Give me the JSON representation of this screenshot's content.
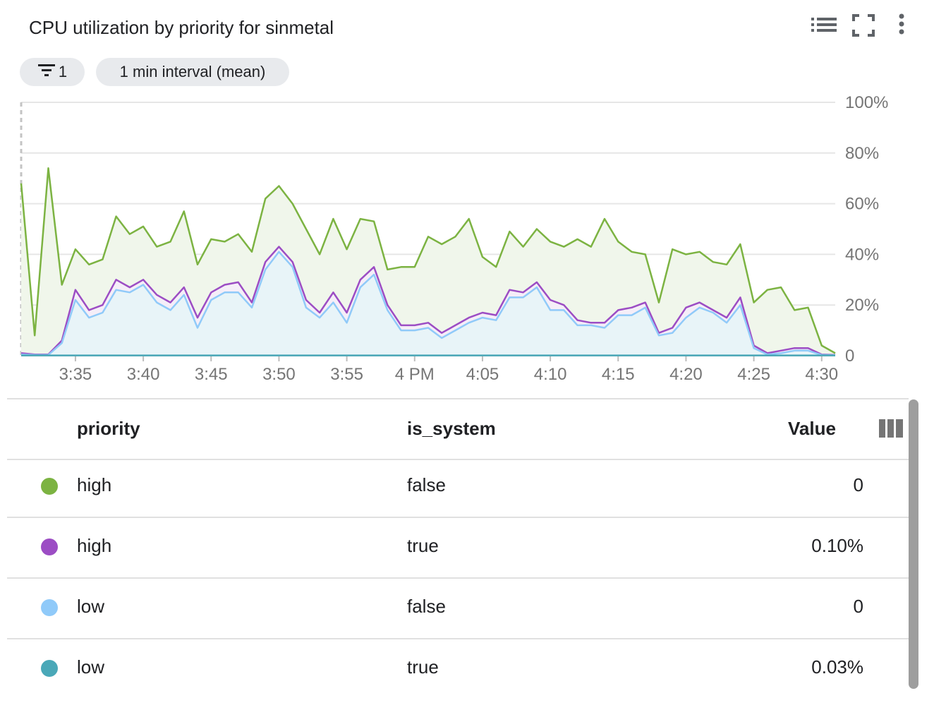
{
  "header": {
    "title": "CPU utilization by priority for sinmetal",
    "filter_chip_label": "1",
    "interval_chip_label": "1 min interval (mean)"
  },
  "colors": {
    "high_false": "#7cb342",
    "high_true": "#9c4dc4",
    "low_false": "#90caf9",
    "low_true": "#4aa8b8"
  },
  "chart_data": {
    "type": "area",
    "x_tick_labels": [
      "3:35",
      "3:40",
      "3:45",
      "3:50",
      "3:55",
      "4 PM",
      "4:05",
      "4:10",
      "4:15",
      "4:20",
      "4:25",
      "4:30"
    ],
    "y_tick_labels": [
      "100%",
      "80%",
      "60%",
      "40%",
      "20%",
      "0"
    ],
    "ylim": [
      0,
      100
    ],
    "grid": true,
    "x_start": "3:31",
    "x_end": "4:30",
    "series": [
      {
        "name": "high / false",
        "color": "#7cb342",
        "values": [
          68,
          8,
          74,
          28,
          42,
          36,
          38,
          55,
          48,
          51,
          43,
          45,
          57,
          36,
          46,
          45,
          48,
          41,
          62,
          67,
          60,
          50,
          40,
          54,
          42,
          54,
          53,
          34,
          35,
          35,
          47,
          44,
          47,
          54,
          39,
          35,
          49,
          43,
          50,
          45,
          43,
          46,
          43,
          54,
          45,
          41,
          40,
          21,
          42,
          40,
          41,
          37,
          36,
          44,
          21,
          26,
          27,
          18,
          19,
          4,
          1
        ]
      },
      {
        "name": "high / true",
        "color": "#9c4dc4",
        "values": [
          1,
          0.5,
          0.5,
          6,
          26,
          18,
          20,
          30,
          27,
          30,
          24,
          21,
          27,
          15,
          25,
          28,
          29,
          21,
          37,
          43,
          37,
          22,
          17,
          25,
          17,
          30,
          35,
          20,
          12,
          12,
          13,
          9,
          12,
          15,
          17,
          16,
          26,
          25,
          29,
          22,
          20,
          14,
          13,
          13,
          18,
          19,
          21,
          9,
          11,
          19,
          21,
          18,
          15,
          23,
          4,
          1,
          2,
          3,
          3,
          0.5,
          0.3
        ]
      },
      {
        "name": "low / false",
        "color": "#90caf9",
        "values": [
          0.5,
          0.3,
          0.3,
          5,
          22,
          15,
          17,
          26,
          25,
          28,
          21,
          18,
          24,
          11,
          22,
          25,
          25,
          19,
          34,
          41,
          35,
          19,
          15,
          21,
          13,
          27,
          32,
          18,
          10,
          10,
          11,
          7,
          10,
          13,
          15,
          14,
          23,
          23,
          27,
          18,
          18,
          12,
          12,
          11,
          16,
          16,
          19,
          8,
          9,
          15,
          19,
          17,
          13,
          20,
          3,
          0.5,
          1,
          2,
          2,
          0.3,
          0.2
        ]
      },
      {
        "name": "low / true",
        "color": "#4aa8b8",
        "values": [
          0.1,
          0.1,
          0.1,
          0.1,
          0.1,
          0.1,
          0.1,
          0.1,
          0.1,
          0.1,
          0.1,
          0.1,
          0.1,
          0.1,
          0.1,
          0.1,
          0.1,
          0.1,
          0.1,
          0.1,
          0.1,
          0.1,
          0.1,
          0.1,
          0.1,
          0.1,
          0.1,
          0.1,
          0.1,
          0.1,
          0.1,
          0.1,
          0.1,
          0.1,
          0.1,
          0.1,
          0.1,
          0.1,
          0.1,
          0.1,
          0.1,
          0.1,
          0.1,
          0.1,
          0.1,
          0.1,
          0.1,
          0.1,
          0.1,
          0.1,
          0.1,
          0.1,
          0.1,
          0.1,
          0.1,
          0.1,
          0.1,
          0.1,
          0.1,
          0.1,
          0.1
        ]
      }
    ]
  },
  "table": {
    "columns": [
      "priority",
      "is_system",
      "Value"
    ],
    "rows": [
      {
        "priority": "high",
        "is_system": "false",
        "value": "0",
        "color": "#7cb342"
      },
      {
        "priority": "high",
        "is_system": "true",
        "value": "0.10%",
        "color": "#9c4dc4"
      },
      {
        "priority": "low",
        "is_system": "false",
        "value": "0",
        "color": "#90caf9"
      },
      {
        "priority": "low",
        "is_system": "true",
        "value": "0.03%",
        "color": "#4aa8b8"
      }
    ]
  }
}
